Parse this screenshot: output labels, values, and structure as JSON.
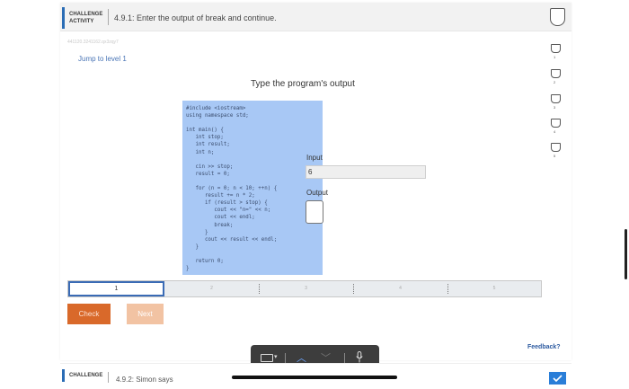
{
  "header": {
    "badge_line1": "CHALLENGE",
    "badge_line2": "ACTIVITY",
    "title": "4.9.1: Enter the output of break and continue."
  },
  "activity_id": "441120.3241162.qx3zqy7",
  "jump_link": "Jump to level 1",
  "prompt": "Type the program's output",
  "code_lines": [
    "#include <iostream>",
    "using namespace std;",
    "",
    "int main() {",
    "   int stop;",
    "   int result;",
    "   int n;",
    "",
    "   cin >> stop;",
    "   result = 0;",
    "",
    "   for (n = 0; n < 10; ++n) {",
    "      result += n * 2;",
    "      if (result > stop) {",
    "         cout << \"n=\" << n;",
    "         cout << endl;",
    "         break;",
    "      }",
    "      cout << result << endl;",
    "   }",
    "",
    "   return 0;",
    "}"
  ],
  "input": {
    "label": "Input",
    "value": "6"
  },
  "output": {
    "label": "Output",
    "value": ""
  },
  "levels": [
    "1",
    "2",
    "3",
    "4",
    "5"
  ],
  "progress_segments": [
    "1",
    "2",
    "3",
    "4",
    "5"
  ],
  "active_level": "1",
  "buttons": {
    "check": "Check",
    "next": "Next"
  },
  "feedback": "Feedback?",
  "bottom": {
    "badge": "CHALLENGE",
    "title": "4.9.2: Simon says"
  },
  "colors": {
    "accent": "#2a6cb5",
    "check": "#d9692a",
    "next": "#f2c3a3",
    "code_bg": "#a8c8f5"
  },
  "icons": [
    "shield-icon",
    "keyboard-icon",
    "chevron-up-icon",
    "chevron-down-icon",
    "microphone-icon",
    "checkmark-icon"
  ]
}
